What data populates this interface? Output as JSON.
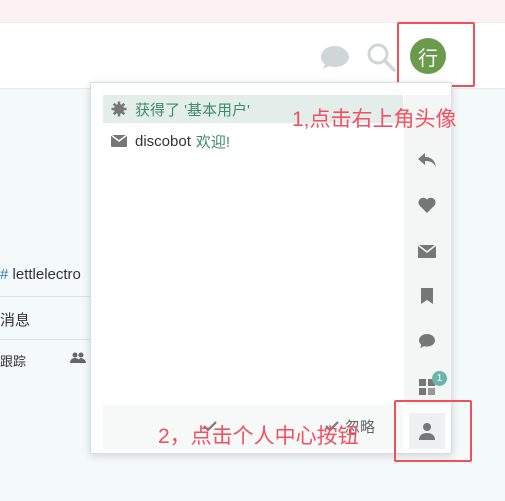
{
  "header": {
    "avatar_letter": "行",
    "icons": [
      "chat-icon",
      "search-icon"
    ]
  },
  "background": {
    "user_link": "lettlelectro",
    "messages_label": "消息",
    "tracking_label": "跟踪"
  },
  "menu": {
    "notifications": [
      {
        "icon": "badge-gear-icon",
        "text": "获得了 '基本用户'"
      },
      {
        "icon": "envelope-icon",
        "sender": "discobot",
        "text": "欢迎!"
      }
    ],
    "panel_icons": [
      "reply-icon",
      "heart-icon",
      "envelope-icon",
      "bookmark-icon",
      "chat-icon",
      "badge-icon"
    ],
    "badge_count": "1",
    "footer": {
      "dismiss_label": "忽略"
    }
  },
  "annotations": {
    "step1": "1,点击右上角头像",
    "step2": "2，点击个人中心按钮"
  },
  "colors": {
    "accent": "#f0505a",
    "avatar_bg": "#6c9a4b",
    "link": "#3d8c6a",
    "selected_row": "#e3eeea"
  }
}
